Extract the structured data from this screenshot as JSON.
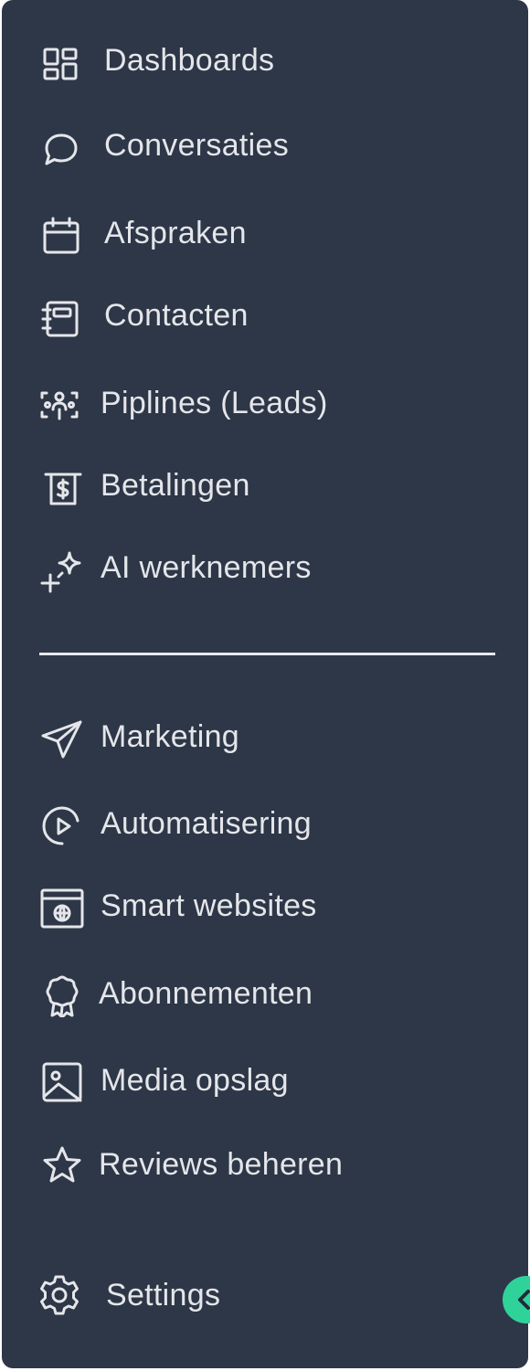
{
  "sidebar": {
    "items": [
      {
        "label": "Dashboards",
        "icon": "dashboard-grid-icon"
      },
      {
        "label": "Conversaties",
        "icon": "chat-bubble-icon"
      },
      {
        "label": "Afspraken",
        "icon": "calendar-icon"
      },
      {
        "label": "Contacten",
        "icon": "contact-book-icon"
      },
      {
        "label": "Piplines (Leads)",
        "icon": "pipeline-people-icon"
      },
      {
        "label": "Betalingen",
        "icon": "invoice-dollar-icon"
      },
      {
        "label": "AI werknemers",
        "icon": "sparkle-icon"
      },
      {
        "label": "Marketing",
        "icon": "send-icon"
      },
      {
        "label": "Automatisering",
        "icon": "play-circle-icon"
      },
      {
        "label": "Smart websites",
        "icon": "browser-globe-icon"
      },
      {
        "label": "Abonnementen",
        "icon": "award-badge-icon"
      },
      {
        "label": "Media opslag",
        "icon": "image-icon"
      },
      {
        "label": "Reviews beheren",
        "icon": "star-icon"
      }
    ],
    "settings": {
      "label": "Settings",
      "icon": "gear-icon"
    },
    "collapse_button": {
      "icon": "chevron-left-icon",
      "color": "#2fd39a"
    }
  },
  "colors": {
    "background": "#2e3747",
    "text": "#e4e6ea",
    "accent": "#2fd39a"
  }
}
